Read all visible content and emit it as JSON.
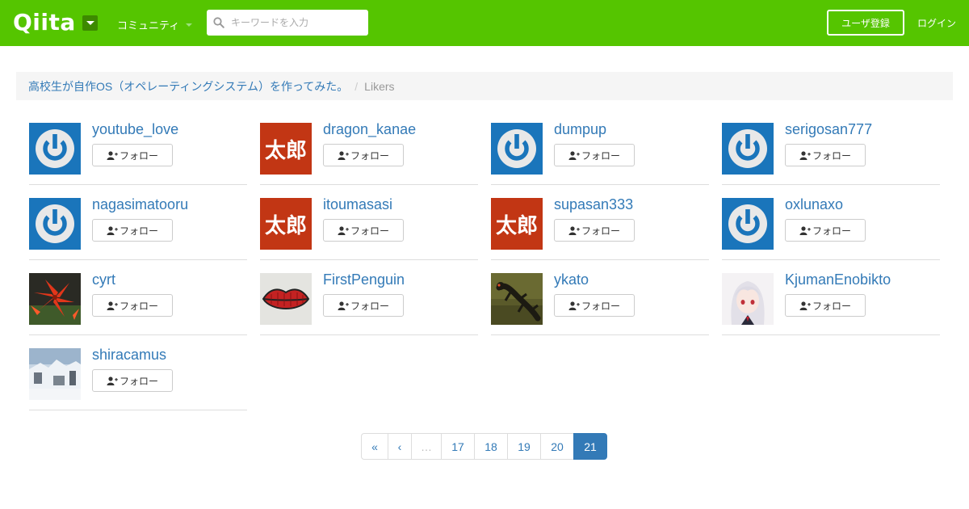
{
  "header": {
    "logo": "Qiita",
    "community_label": "コミュニティ",
    "search_placeholder": "キーワードを入力",
    "signup_label": "ユーザ登録",
    "login_label": "ログイン",
    "brand_color": "#55c500"
  },
  "breadcrumb": {
    "article_title": "高校生が自作OS（オペレーティングシステム）を作ってみた。",
    "separator": "/",
    "current": "Likers"
  },
  "users": [
    {
      "name": "youtube_love",
      "avatar": "default-power-icon",
      "follow_label": "フォロー"
    },
    {
      "name": "dragon_kanae",
      "avatar": "taro-icon",
      "follow_label": "フォロー"
    },
    {
      "name": "dumpup",
      "avatar": "default-power-icon",
      "follow_label": "フォロー"
    },
    {
      "name": "serigosan777",
      "avatar": "default-power-icon",
      "follow_label": "フォロー"
    },
    {
      "name": "nagasimatooru",
      "avatar": "default-power-icon",
      "follow_label": "フォロー"
    },
    {
      "name": "itoumasasi",
      "avatar": "taro-icon",
      "follow_label": "フォロー"
    },
    {
      "name": "supasan333",
      "avatar": "taro-icon",
      "follow_label": "フォロー"
    },
    {
      "name": "oxlunaxo",
      "avatar": "default-power-icon",
      "follow_label": "フォロー"
    },
    {
      "name": "cyrt",
      "avatar": "red-flower-photo",
      "follow_label": "フォロー"
    },
    {
      "name": "FirstPenguin",
      "avatar": "lips-drawing",
      "follow_label": "フォロー"
    },
    {
      "name": "ykato",
      "avatar": "salamander-photo",
      "follow_label": "フォロー"
    },
    {
      "name": "KjumanEnobikto",
      "avatar": "anime-girl-illustration",
      "follow_label": "フォロー"
    },
    {
      "name": "shiracamus",
      "avatar": "snow-scene-photo",
      "follow_label": "フォロー"
    }
  ],
  "taro_text": "太郎",
  "pagination": {
    "first": "«",
    "prev": "‹",
    "ellipsis": "…",
    "pages": [
      "17",
      "18",
      "19",
      "20",
      "21"
    ],
    "current": "21"
  }
}
